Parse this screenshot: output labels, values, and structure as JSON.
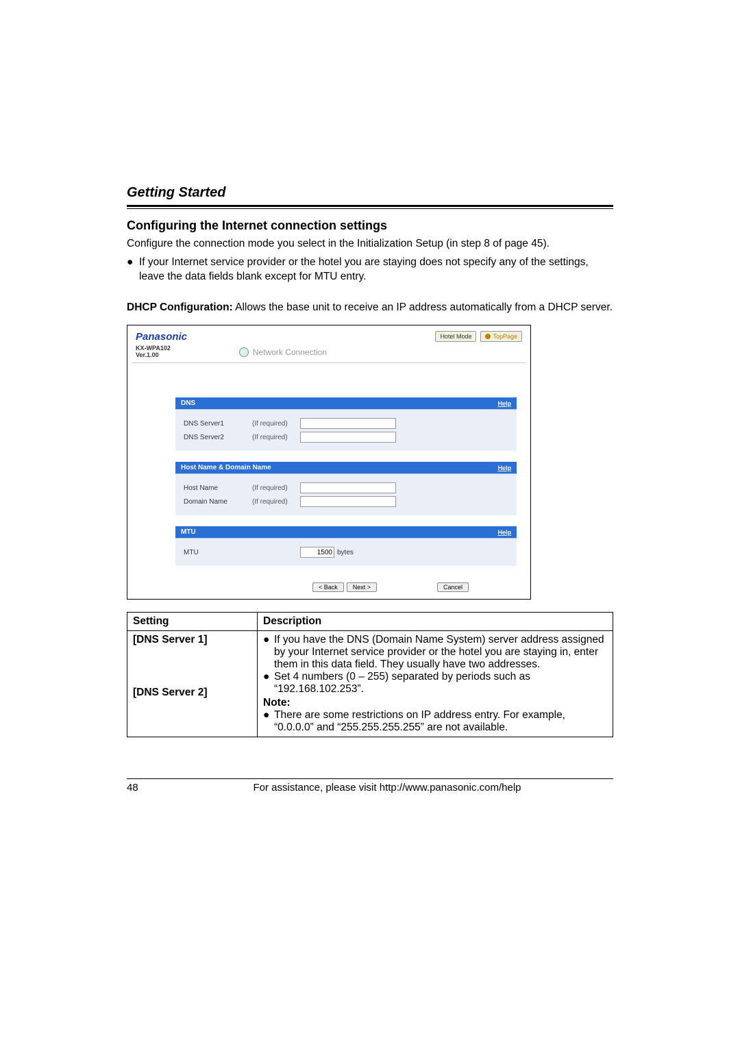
{
  "chapter": "Getting Started",
  "section_title": "Configuring the Internet connection settings",
  "intro": "Configure the connection mode you select in the Initialization Setup (in step 8 of page 45).",
  "bullet1": "If your Internet service provider or the hotel you are staying does not specify any of the settings, leave the data fields blank except for MTU entry.",
  "dhcp_label": "DHCP Configuration:",
  "dhcp_text": " Allows the base unit to receive an IP address automatically from a DHCP server.",
  "shot": {
    "brand": "Panasonic",
    "hotel_mode": "Hotel Mode",
    "top_page": "TopPage",
    "model": "KX-WPA102",
    "version": "Ver.1.00",
    "net_title": "Network Connection",
    "dns_header": "DNS",
    "dns1_label": "DNS Server1",
    "dns2_label": "DNS Server2",
    "if_required": "(If required)",
    "host_header": "Host Name & Domain Name",
    "host_label": "Host Name",
    "domain_label": "Domain Name",
    "mtu_header": "MTU",
    "mtu_label": "MTU",
    "mtu_value": "1500",
    "mtu_unit": "bytes",
    "help": "Help",
    "back": "< Back",
    "next": "Next >",
    "cancel": "Cancel"
  },
  "table": {
    "h1": "Setting",
    "h2": "Description",
    "dns1": "[DNS Server 1]",
    "dns2": "[DNS Server 2]",
    "desc1": "If you have the DNS (Domain Name System) server address assigned by your Internet service provider or the hotel you are staying in, enter them in this data field. They usually have two addresses.",
    "desc2": "Set 4 numbers (0 – 255) separated by periods such as “192.168.102.253”.",
    "note_label": "Note:",
    "desc3": "There are some restrictions on IP address entry. For example, “0.0.0.0” and “255.255.255.255” are not available."
  },
  "footer": {
    "page": "48",
    "assist": "For assistance, please visit http://www.panasonic.com/help"
  }
}
